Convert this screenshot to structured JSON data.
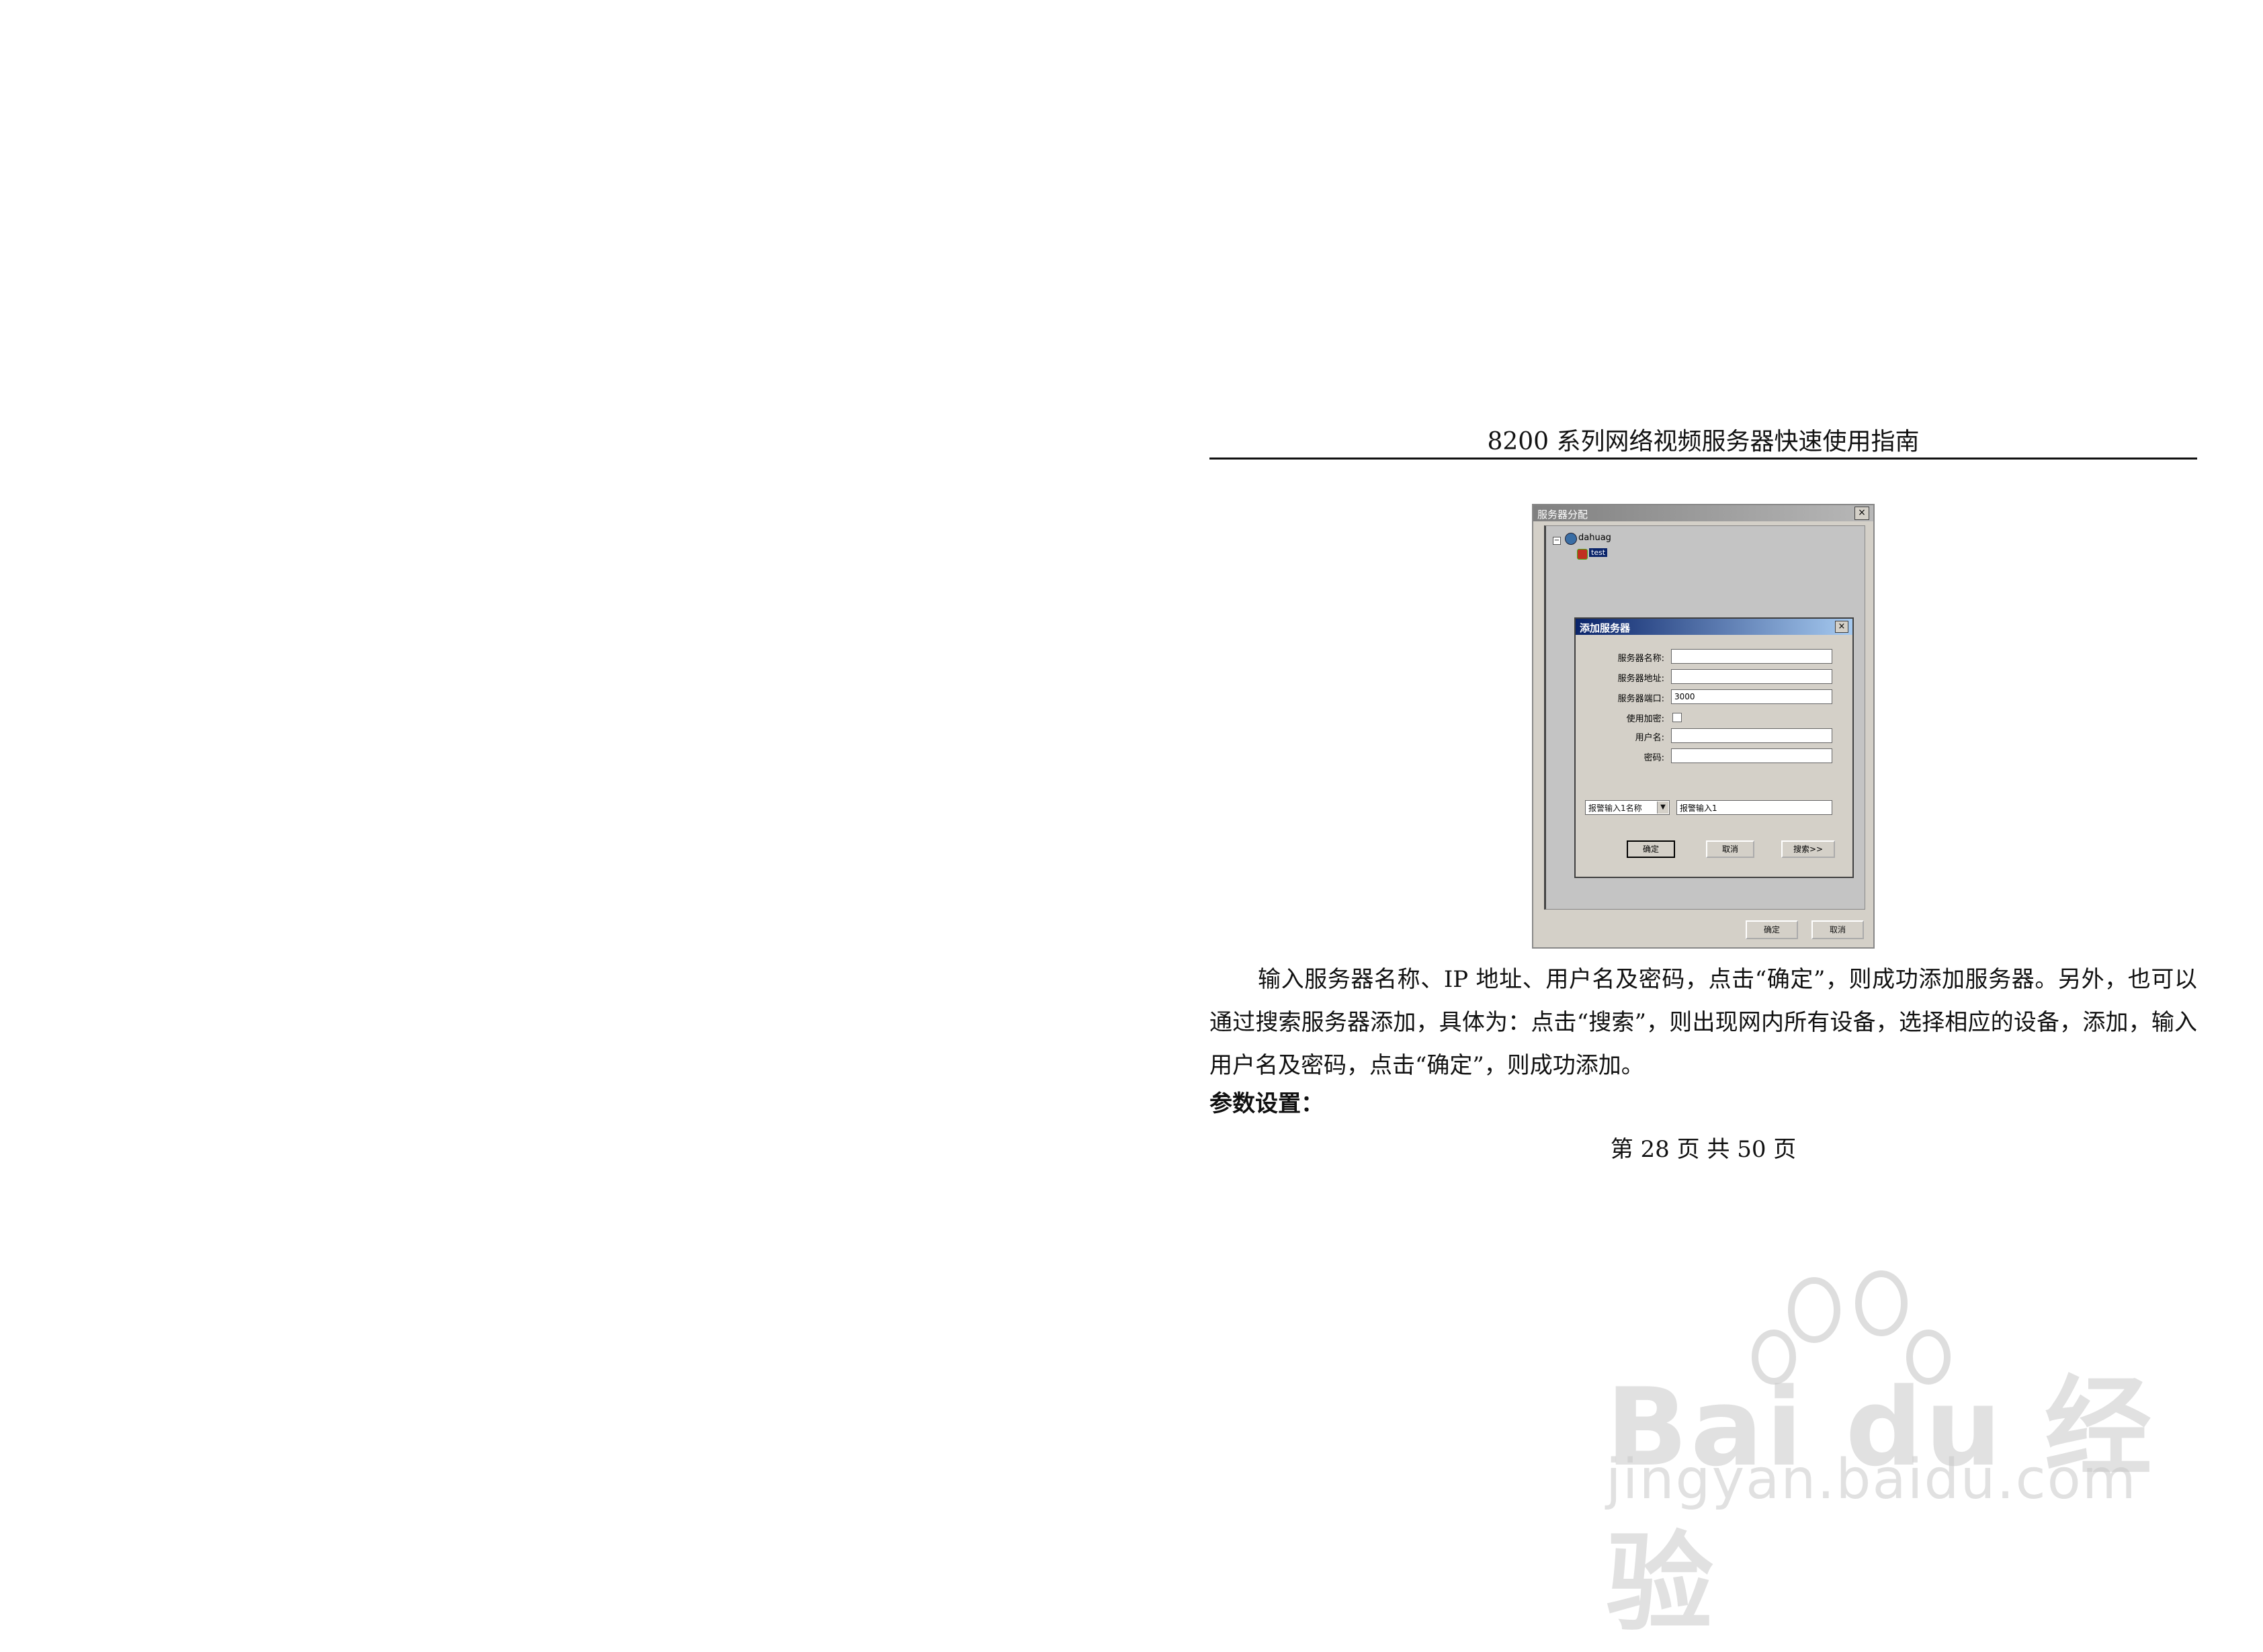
{
  "header": {
    "title": "8200 系列网络视频服务器快速使用指南"
  },
  "screenshot": {
    "window_title": "服务器分配",
    "close_glyph": "×",
    "tree": {
      "expander": "−",
      "root_label": "dahuag",
      "child_label": "test"
    },
    "dialog": {
      "title": "添加服务器",
      "close_glyph": "×",
      "fields": {
        "server_name_label": "服务器名称:",
        "server_address_label": "服务器地址:",
        "server_port_label": "服务器端口:",
        "server_port_value": "3000",
        "use_encryption_label": "使用加密:",
        "username_label": "用户名:",
        "password_label": "密码:"
      },
      "alarm_select_value": "报警输入1名称",
      "alarm_select_arrow": "▼",
      "alarm_input_value": "报警输入1",
      "buttons": {
        "ok": "确定",
        "cancel": "取消",
        "search": "搜索>>"
      }
    },
    "footer_buttons": {
      "ok": "确定",
      "cancel": "取消"
    }
  },
  "body": {
    "paragraph": "输入服务器名称、IP 地址、用户名及密码，点击“确定”，则成功添加服务器。另外，也可以通过搜索服务器添加，具体为：点击“搜索”，则出现网内所有设备，选择相应的设备，添加，输入用户名及密码，点击“确定”，则成功添加。",
    "section_title": "参数设置："
  },
  "footer": {
    "page_text": "第 28 页 共 50 页"
  },
  "watermark": {
    "brand": "Bai du 经验",
    "url": "jingyan.baidu.com"
  }
}
